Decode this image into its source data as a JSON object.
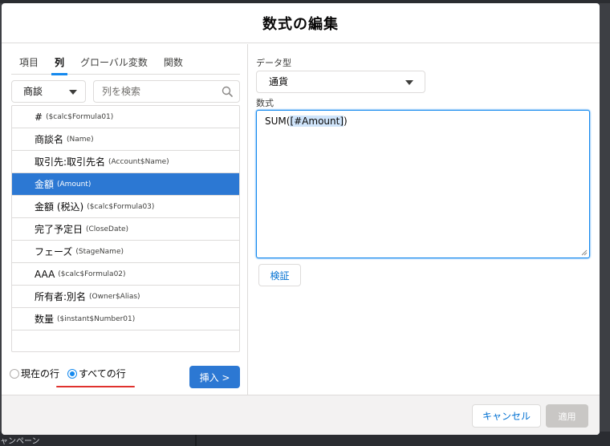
{
  "background": {
    "left_text": "ャンペーン"
  },
  "modal": {
    "title": "数式の編集"
  },
  "tabs": [
    {
      "label": "項目",
      "active": false
    },
    {
      "label": "列",
      "active": true
    },
    {
      "label": "グローバル変数",
      "active": false
    },
    {
      "label": "関数",
      "active": false
    }
  ],
  "object_select": {
    "value": "商談"
  },
  "search": {
    "placeholder": "列を検索",
    "value": ""
  },
  "fields": [
    {
      "name": "#",
      "api": "($calc$Formula01)",
      "selected": false
    },
    {
      "name": "商談名",
      "api": "(Name)",
      "selected": false
    },
    {
      "name": "取引先:取引先名",
      "api": "(Account$Name)",
      "selected": false
    },
    {
      "name": "金額",
      "api": "(Amount)",
      "selected": true
    },
    {
      "name": "金額 (税込)",
      "api": "($calc$Formula03)",
      "selected": false
    },
    {
      "name": "完了予定日",
      "api": "(CloseDate)",
      "selected": false
    },
    {
      "name": "フェーズ",
      "api": "(StageName)",
      "selected": false
    },
    {
      "name": "AAA",
      "api": "($calc$Formula02)",
      "selected": false
    },
    {
      "name": "所有者:別名",
      "api": "(Owner$Alias)",
      "selected": false
    },
    {
      "name": "数量",
      "api": "($instant$Number01)",
      "selected": false
    }
  ],
  "scope": {
    "current_row": "現在の行",
    "all_rows": "すべての行",
    "selected": "all_rows"
  },
  "insert": {
    "label": "挿入 >"
  },
  "data_type": {
    "label": "データ型",
    "value": "通貨"
  },
  "formula": {
    "label": "数式",
    "prefix": "SUM(",
    "highlight": "[#Amount]",
    "suffix": ")"
  },
  "verify": {
    "label": "検証"
  },
  "footer": {
    "cancel_label": "キャンセル",
    "apply_label": "適用"
  },
  "colors": {
    "accent": "#2c78d3",
    "link": "#0070d2",
    "underline": "#e0322e",
    "disabled": "#c9c7c5"
  }
}
